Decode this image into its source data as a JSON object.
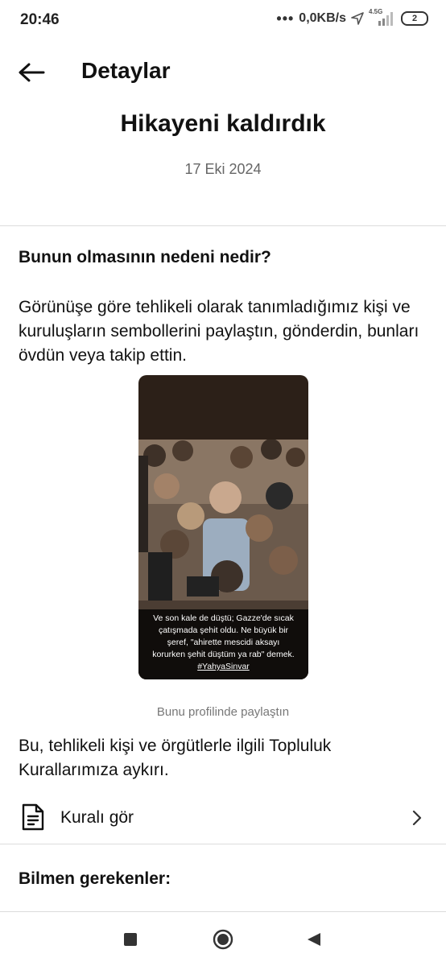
{
  "status_bar": {
    "time": "20:46",
    "network_speed": "0,0KB/s",
    "network_type": "4.5G",
    "battery_level": "2",
    "icons": [
      "dots-icon",
      "location-arrow-icon",
      "signal-icon",
      "battery-icon"
    ]
  },
  "header": {
    "title": "Detaylar",
    "back_icon": "arrow-left-icon"
  },
  "notice": {
    "headline": "Hikayeni kaldırdık",
    "date": "17 Eki 2024"
  },
  "reason": {
    "title": "Bunun olmasının nedeni nedir?",
    "description": "Görünüşe göre tehlikeli olarak tanımladığımız kişi ve kuruluşların sembollerini paylaştın, gönderdin, bunları övdün veya takip ettin."
  },
  "story": {
    "caption_lines": [
      "Ve son kale de düştü; Gazze'de sıcak",
      "çatışmada şehit oldu. Ne büyük bir",
      "şeref, \"ahirette mescidi aksayı",
      "korurken şehit düştüm ya rab\" demek."
    ],
    "hashtag": "#YahyaSinvar",
    "shared_note": "Bunu profilinde paylaştın"
  },
  "policy": {
    "text": "Bu, tehlikeli kişi ve örgütlerle ilgili Topluluk Kurallarımıza aykırı.",
    "rule_link_label": "Kuralı gör",
    "rule_icon": "document-icon",
    "chevron_icon": "chevron-right-icon"
  },
  "info": {
    "title": "Bilmen gerekenler:"
  },
  "nav_bar": {
    "icons": [
      "recents-square-icon",
      "home-circle-icon",
      "back-triangle-icon"
    ]
  },
  "colors": {
    "background": "#ffffff",
    "text": "#111111",
    "muted": "#666666",
    "divider": "#dcdcdc"
  }
}
